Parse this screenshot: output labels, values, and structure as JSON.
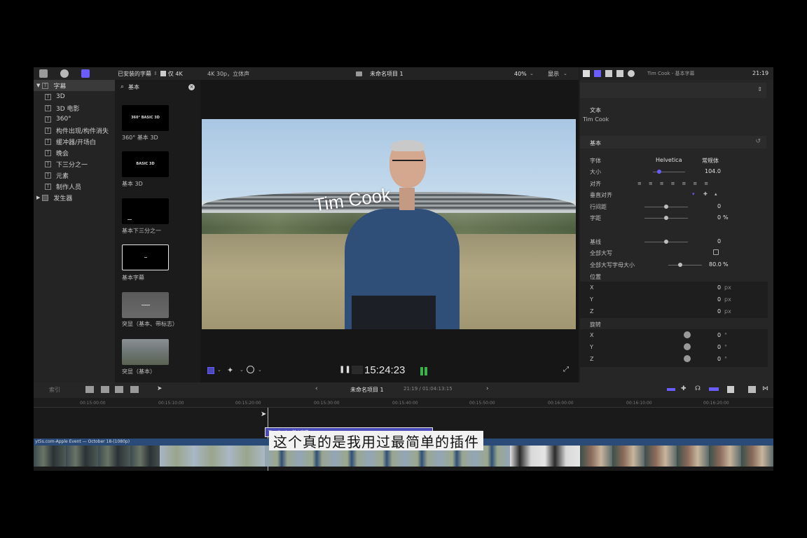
{
  "library": {
    "installed_label": "已安装的字幕",
    "only4k_label": "仅 4K",
    "root_label": "字幕",
    "items": [
      "3D",
      "3D 电影",
      "360°",
      "构件出现/构件消失",
      "缓冲器/开场白",
      "晚会",
      "下三分之一",
      "元素",
      "制作人员"
    ],
    "generators_label": "发生器"
  },
  "browser": {
    "search_value": "基本",
    "thumbs": [
      {
        "title": "360° BASIC 3D",
        "label": "360° 基本 3D"
      },
      {
        "title": "BASIC 3D",
        "label": "基本 3D"
      },
      {
        "title": "",
        "label": "基本下三分之一"
      },
      {
        "title": "",
        "label": "基本字幕"
      },
      {
        "title": "",
        "label": "突显（基本、带标志）"
      },
      {
        "title": "",
        "label": "突显（基本）"
      }
    ]
  },
  "viewer": {
    "format": "4K 30p，立体声",
    "project_title": "未命名项目 1",
    "zoom": "40%",
    "display_label": "显示",
    "overlay_title": "Tim Cook",
    "timecode": "15:24:23"
  },
  "inspector": {
    "header": "Tim Cook - 基本字幕",
    "duration": "21:19",
    "text_section": "文本",
    "text_value": "Tim Cook",
    "basic_section": "基本",
    "font_label": "字体",
    "font_value": "Helvetica",
    "font_style": "常规体",
    "size_label": "大小",
    "size_value": "104.0",
    "align_label": "对齐",
    "valign_label": "垂直对齐",
    "line_spacing_label": "行间距",
    "line_spacing_value": "0",
    "tracking_label": "字距",
    "tracking_value": "0",
    "tracking_unit": "%",
    "baseline_label": "基线",
    "baseline_value": "0",
    "all_caps_label": "全部大写",
    "all_caps_size_label": "全部大写字母大小",
    "all_caps_size_value": "80.0",
    "all_caps_size_unit": "%",
    "position_label": "位置",
    "pos": [
      {
        "axis": "X",
        "value": "0",
        "unit": "px"
      },
      {
        "axis": "Y",
        "value": "0",
        "unit": "px"
      },
      {
        "axis": "Z",
        "value": "0",
        "unit": "px"
      }
    ],
    "rotation_label": "旋转",
    "rot": [
      {
        "axis": "X",
        "value": "0",
        "unit": "°"
      },
      {
        "axis": "Y",
        "value": "0",
        "unit": "°"
      },
      {
        "axis": "Z",
        "value": "0",
        "unit": "°"
      }
    ]
  },
  "timeline": {
    "index_label": "索引",
    "project_title": "未命名项目 1",
    "timecode": "21:19 / 01:04:13:15",
    "ticks": [
      "00:15:00:00",
      "00:15:10:00",
      "00:15:20:00",
      "00:15:30:00",
      "00:15:40:00",
      "00:15:50:00",
      "00:16:00:00",
      "00:16:10:00",
      "00:16:20:00"
    ],
    "title_clip": "Tim Cook - 基本字幕",
    "source_clip": "yt5s.com-Apple Event — October 18-(1080p)"
  },
  "subtitle": "这个真的是我用过最简单的插件",
  "colors": {
    "accent": "#6a5cff",
    "selection": "#4a49b8",
    "clip_blue": "#2a4a78"
  }
}
